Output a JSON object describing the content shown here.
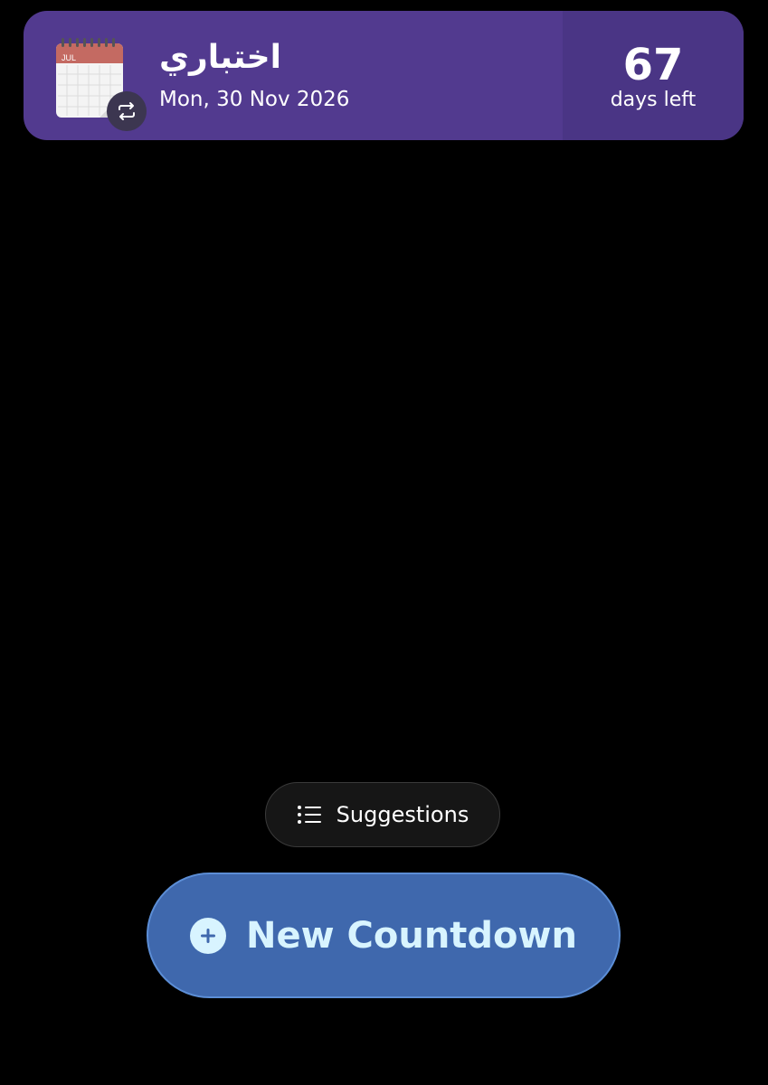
{
  "countdown": {
    "title": "اختباري",
    "date": "Mon, 30 Nov 2026",
    "days_number": "67",
    "days_label": "days left",
    "calendar_month": "JUL",
    "icon": "calendar-icon",
    "repeat_icon": "repeat-icon"
  },
  "suggestions": {
    "label": "Suggestions",
    "icon": "list-icon"
  },
  "new_countdown": {
    "label": "New Countdown",
    "icon": "plus-circle-icon"
  },
  "colors": {
    "background": "#000000",
    "card": "#523a8f",
    "card_right": "#4a3585",
    "primary_button": "#3f68ad",
    "primary_button_text": "#d8f4ff"
  }
}
